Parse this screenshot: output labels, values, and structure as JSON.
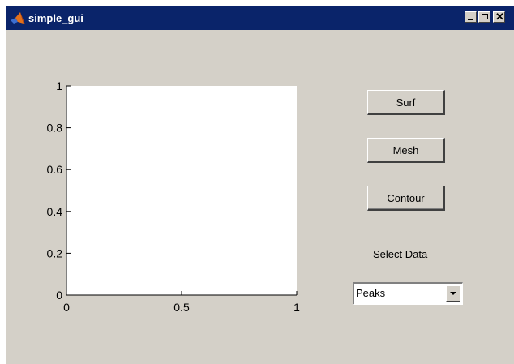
{
  "window": {
    "title": "simple_gui",
    "title_bar_color": "#0a246a",
    "background_color": "#d4d0c8",
    "app_icon": "matlab-logo-icon",
    "controls": [
      "minimize-icon",
      "maximize-icon",
      "close-icon"
    ],
    "close_glyph": "✕"
  },
  "axes": {
    "plot_background": "#ffffff"
  },
  "chart_data": {
    "type": "line",
    "title": "",
    "xlabel": "",
    "ylabel": "",
    "xlim": [
      0,
      1
    ],
    "ylim": [
      0,
      1
    ],
    "x_ticks": [
      "0",
      "0.5",
      "1"
    ],
    "y_ticks": [
      "0",
      "0.2",
      "0.4",
      "0.6",
      "0.8",
      "1"
    ],
    "series": [],
    "grid": false
  },
  "buttons": {
    "surf": "Surf",
    "mesh": "Mesh",
    "contour": "Contour"
  },
  "select": {
    "label": "Select Data",
    "value": "Peaks",
    "arrow_icon": "chevron-down-icon"
  }
}
